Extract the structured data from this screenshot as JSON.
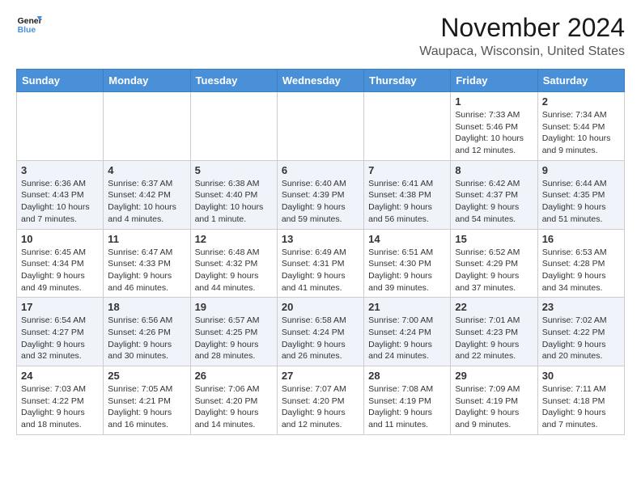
{
  "logo": {
    "line1": "General",
    "line2": "Blue"
  },
  "title": "November 2024",
  "location": "Waupaca, Wisconsin, United States",
  "days_of_week": [
    "Sunday",
    "Monday",
    "Tuesday",
    "Wednesday",
    "Thursday",
    "Friday",
    "Saturday"
  ],
  "weeks": [
    [
      {
        "date": "",
        "info": ""
      },
      {
        "date": "",
        "info": ""
      },
      {
        "date": "",
        "info": ""
      },
      {
        "date": "",
        "info": ""
      },
      {
        "date": "",
        "info": ""
      },
      {
        "date": "1",
        "info": "Sunrise: 7:33 AM\nSunset: 5:46 PM\nDaylight: 10 hours and 12 minutes."
      },
      {
        "date": "2",
        "info": "Sunrise: 7:34 AM\nSunset: 5:44 PM\nDaylight: 10 hours and 9 minutes."
      }
    ],
    [
      {
        "date": "3",
        "info": "Sunrise: 6:36 AM\nSunset: 4:43 PM\nDaylight: 10 hours and 7 minutes."
      },
      {
        "date": "4",
        "info": "Sunrise: 6:37 AM\nSunset: 4:42 PM\nDaylight: 10 hours and 4 minutes."
      },
      {
        "date": "5",
        "info": "Sunrise: 6:38 AM\nSunset: 4:40 PM\nDaylight: 10 hours and 1 minute."
      },
      {
        "date": "6",
        "info": "Sunrise: 6:40 AM\nSunset: 4:39 PM\nDaylight: 9 hours and 59 minutes."
      },
      {
        "date": "7",
        "info": "Sunrise: 6:41 AM\nSunset: 4:38 PM\nDaylight: 9 hours and 56 minutes."
      },
      {
        "date": "8",
        "info": "Sunrise: 6:42 AM\nSunset: 4:37 PM\nDaylight: 9 hours and 54 minutes."
      },
      {
        "date": "9",
        "info": "Sunrise: 6:44 AM\nSunset: 4:35 PM\nDaylight: 9 hours and 51 minutes."
      }
    ],
    [
      {
        "date": "10",
        "info": "Sunrise: 6:45 AM\nSunset: 4:34 PM\nDaylight: 9 hours and 49 minutes."
      },
      {
        "date": "11",
        "info": "Sunrise: 6:47 AM\nSunset: 4:33 PM\nDaylight: 9 hours and 46 minutes."
      },
      {
        "date": "12",
        "info": "Sunrise: 6:48 AM\nSunset: 4:32 PM\nDaylight: 9 hours and 44 minutes."
      },
      {
        "date": "13",
        "info": "Sunrise: 6:49 AM\nSunset: 4:31 PM\nDaylight: 9 hours and 41 minutes."
      },
      {
        "date": "14",
        "info": "Sunrise: 6:51 AM\nSunset: 4:30 PM\nDaylight: 9 hours and 39 minutes."
      },
      {
        "date": "15",
        "info": "Sunrise: 6:52 AM\nSunset: 4:29 PM\nDaylight: 9 hours and 37 minutes."
      },
      {
        "date": "16",
        "info": "Sunrise: 6:53 AM\nSunset: 4:28 PM\nDaylight: 9 hours and 34 minutes."
      }
    ],
    [
      {
        "date": "17",
        "info": "Sunrise: 6:54 AM\nSunset: 4:27 PM\nDaylight: 9 hours and 32 minutes."
      },
      {
        "date": "18",
        "info": "Sunrise: 6:56 AM\nSunset: 4:26 PM\nDaylight: 9 hours and 30 minutes."
      },
      {
        "date": "19",
        "info": "Sunrise: 6:57 AM\nSunset: 4:25 PM\nDaylight: 9 hours and 28 minutes."
      },
      {
        "date": "20",
        "info": "Sunrise: 6:58 AM\nSunset: 4:24 PM\nDaylight: 9 hours and 26 minutes."
      },
      {
        "date": "21",
        "info": "Sunrise: 7:00 AM\nSunset: 4:24 PM\nDaylight: 9 hours and 24 minutes."
      },
      {
        "date": "22",
        "info": "Sunrise: 7:01 AM\nSunset: 4:23 PM\nDaylight: 9 hours and 22 minutes."
      },
      {
        "date": "23",
        "info": "Sunrise: 7:02 AM\nSunset: 4:22 PM\nDaylight: 9 hours and 20 minutes."
      }
    ],
    [
      {
        "date": "24",
        "info": "Sunrise: 7:03 AM\nSunset: 4:22 PM\nDaylight: 9 hours and 18 minutes."
      },
      {
        "date": "25",
        "info": "Sunrise: 7:05 AM\nSunset: 4:21 PM\nDaylight: 9 hours and 16 minutes."
      },
      {
        "date": "26",
        "info": "Sunrise: 7:06 AM\nSunset: 4:20 PM\nDaylight: 9 hours and 14 minutes."
      },
      {
        "date": "27",
        "info": "Sunrise: 7:07 AM\nSunset: 4:20 PM\nDaylight: 9 hours and 12 minutes."
      },
      {
        "date": "28",
        "info": "Sunrise: 7:08 AM\nSunset: 4:19 PM\nDaylight: 9 hours and 11 minutes."
      },
      {
        "date": "29",
        "info": "Sunrise: 7:09 AM\nSunset: 4:19 PM\nDaylight: 9 hours and 9 minutes."
      },
      {
        "date": "30",
        "info": "Sunrise: 7:11 AM\nSunset: 4:18 PM\nDaylight: 9 hours and 7 minutes."
      }
    ]
  ]
}
